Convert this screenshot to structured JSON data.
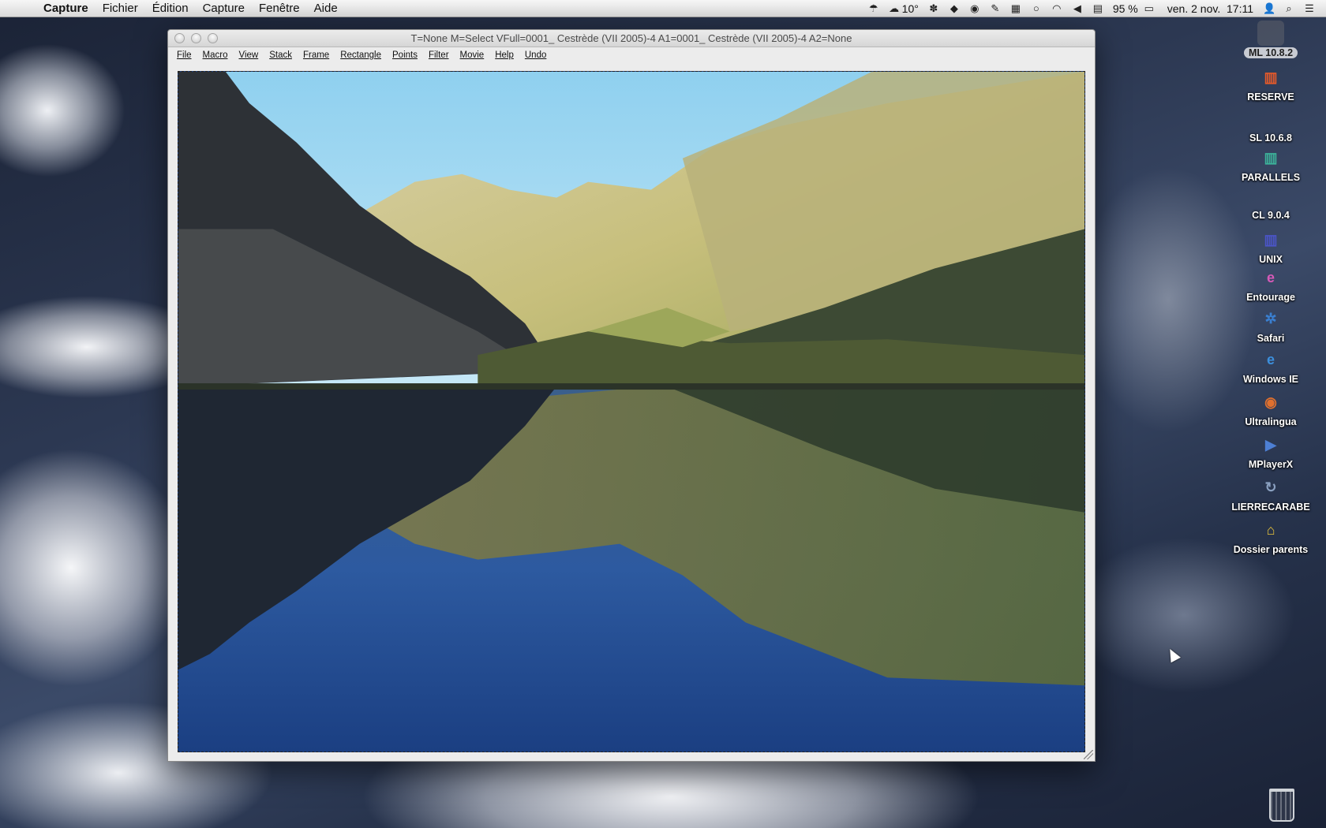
{
  "menubar": {
    "apple": "",
    "items": [
      "Capture",
      "Fichier",
      "Édition",
      "Capture",
      "Fenêtre",
      "Aide"
    ],
    "status": {
      "temperature": "10°",
      "battery": "95 %",
      "datetime": "ven. 2 nov.  17:11"
    }
  },
  "window": {
    "title": "T=None M=Select VFull=0001_ Cestrède (VII 2005)-4 A1=0001_ Cestrède (VII 2005)-4 A2=None",
    "toolbar": [
      "File",
      "Macro",
      "View",
      "Stack",
      "Frame",
      "Rectangle",
      "Points",
      "Filter",
      "Movie",
      "Help",
      "Undo"
    ]
  },
  "desktop_icons": [
    {
      "label": "ML 10.8.2",
      "icon": "apple-disk-icon",
      "color": "#e8463a",
      "glyph": "",
      "selected": true
    },
    {
      "label": "RESERVE",
      "icon": "books-icon",
      "color": "#e65a2a",
      "glyph": "▥",
      "selected": false
    },
    {
      "label": "SL 10.6.8",
      "icon": "apple-disk-icon",
      "color": "#8fd06a",
      "glyph": "",
      "selected": false
    },
    {
      "label": "PARALLELS",
      "icon": "books-icon",
      "color": "#3cb39a",
      "glyph": "▥",
      "selected": false
    },
    {
      "label": "CL 9.0.4",
      "icon": "apple-disk-icon",
      "color": "#4fb7e8",
      "glyph": "",
      "selected": false
    },
    {
      "label": "UNIX",
      "icon": "books-icon",
      "color": "#4b55c8",
      "glyph": "▥",
      "selected": false
    },
    {
      "label": "Entourage",
      "icon": "entourage-icon",
      "color": "#d65ab8",
      "glyph": "e",
      "selected": false
    },
    {
      "label": "Safari",
      "icon": "compass-icon",
      "color": "#3a7fd0",
      "glyph": "✲",
      "selected": false
    },
    {
      "label": "Windows IE",
      "icon": "internet-explorer-icon",
      "color": "#3c8fdc",
      "glyph": "e",
      "selected": false
    },
    {
      "label": "Ultralingua",
      "icon": "ultralingua-icon",
      "color": "#e0702e",
      "glyph": "◉",
      "selected": false
    },
    {
      "label": "MPlayerX",
      "icon": "play-icon",
      "color": "#4d7fd4",
      "glyph": "▶",
      "selected": false
    },
    {
      "label": "LIERRECARABE",
      "icon": "sync-icon",
      "color": "#8aa0c0",
      "glyph": "↻",
      "selected": false
    },
    {
      "label": "Dossier parents",
      "icon": "home-folder-icon",
      "color": "#e6c23a",
      "glyph": "⌂",
      "selected": false
    }
  ]
}
